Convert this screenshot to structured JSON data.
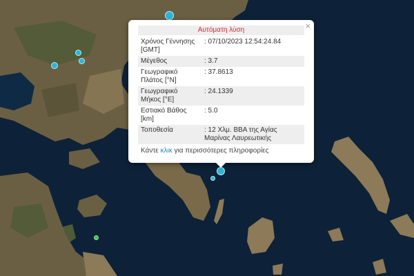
{
  "popup": {
    "title": "Αυτόματη λύση",
    "close_glyph": "×",
    "rows": [
      {
        "label": "Χρόνος Γέννησης [GMT]",
        "value": ": 07/10/2023 12:54:24.84"
      },
      {
        "label": "Μέγεθος",
        "value": ": 3.7"
      },
      {
        "label": "Γεωγραφικό Πλάτος [°N]",
        "value": ": 37.8613"
      },
      {
        "label": "Γεωγραφικό Μήκος [°E]",
        "value": ": 24.1339"
      },
      {
        "label": "Εστιακό Βάθος [km]",
        "value": ": 5.0"
      },
      {
        "label": "Τοποθεσία",
        "value": ": 12 Χλμ. ΒΒΑ της Αγίας Μαρίνας Λαυρεωτικής"
      }
    ],
    "more_prefix": "Κάντε ",
    "more_link": "κλικ",
    "more_suffix": " για περισσότερες πληροφορίες"
  },
  "map": {
    "colors": {
      "sea": "#0d2238",
      "land": "#6b5f43",
      "land_light": "#8c7a58",
      "land_green": "#4f5a36",
      "marker_cyan": "#29b6d9",
      "marker_green": "#39c24a"
    },
    "markers": [
      {
        "name": "selected-quake-marker",
        "color": "marker_cyan"
      },
      {
        "name": "quake-marker-offshore",
        "color": "marker_cyan"
      },
      {
        "name": "quake-marker-north",
        "color": "marker_cyan"
      },
      {
        "name": "quake-marker-west-1",
        "color": "marker_cyan"
      },
      {
        "name": "quake-marker-west-2",
        "color": "marker_cyan"
      },
      {
        "name": "quake-marker-west-3",
        "color": "marker_cyan"
      },
      {
        "name": "quake-marker-green",
        "color": "marker_green"
      }
    ]
  }
}
